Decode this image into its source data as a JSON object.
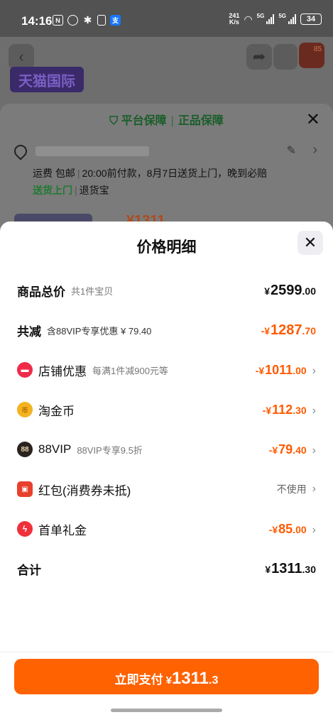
{
  "status": {
    "time": "14:16",
    "net_speed_value": "241",
    "net_speed_unit": "K/s",
    "sig1_label": "5G",
    "sig2_label": "5G",
    "battery": "34"
  },
  "background": {
    "store_tag": "天猫国际",
    "badge": "85",
    "guarantee_a": "平台保障",
    "guarantee_b": "正品保障",
    "shipping": [
      "运费 包邮",
      "20:00前付款，8月7日送货上门，晚到必赔"
    ],
    "service_green": "送货上门",
    "service_plain": "退货宝",
    "price_peek": "¥1311"
  },
  "sheet": {
    "title": "价格明细",
    "rows": [
      {
        "label": "商品总价",
        "sub": "共1件宝贝",
        "currency": "¥",
        "int": "2599",
        "dec": ".00"
      },
      {
        "label": "共减",
        "sub": "含88VIP专享优惠 ¥ 79.40",
        "currency": "-¥",
        "int": "1287",
        "dec": ".70"
      },
      {
        "label": "店铺优惠",
        "sub": "每满1件减900元等",
        "currency": "-¥",
        "int": "1011",
        "dec": ".00",
        "icon": "shop-icon"
      },
      {
        "label": "淘金币",
        "currency": "-¥",
        "int": "112",
        "dec": ".30",
        "icon": "coin-icon",
        "icon_glyph": "币"
      },
      {
        "label": "88VIP",
        "sub": "88VIP专享9.5折",
        "currency": "-¥",
        "int": "79",
        "dec": ".40",
        "icon": "vip-icon",
        "icon_glyph": "88"
      },
      {
        "label": "红包(消费券未抵)",
        "value_text": "不使用",
        "icon": "red-packet-icon"
      },
      {
        "label": "首单礼金",
        "currency": "-¥",
        "int": "85",
        "dec": ".00",
        "icon": "lightning-icon"
      },
      {
        "label": "合计",
        "currency": "¥",
        "int": "1311",
        "dec": ".30"
      }
    ],
    "pay_button": {
      "label": "立即支付",
      "currency": "¥",
      "int": "1311",
      "dec": ".3"
    }
  },
  "colors": {
    "accent": "#ff6200",
    "discount": "#ff5a00",
    "guarantee_green": "#1f7a30"
  }
}
